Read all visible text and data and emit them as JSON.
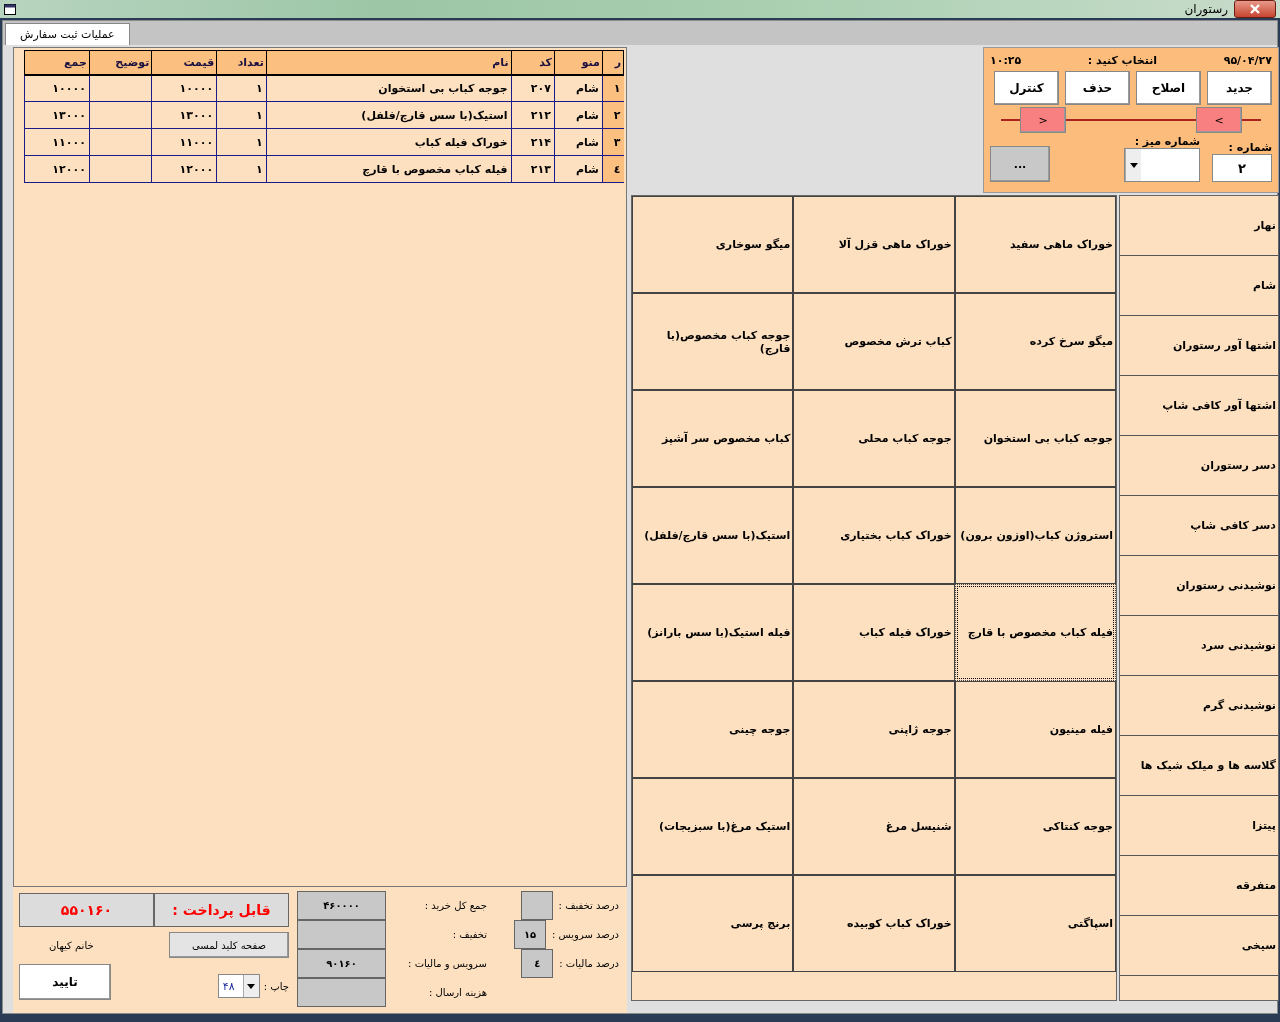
{
  "window": {
    "title": "رستوران"
  },
  "tabs": [
    {
      "label": "عملیات ثبت سفارش",
      "selected": true
    }
  ],
  "order_table": {
    "columns": [
      "ر",
      "منو",
      "کد",
      "نام",
      "تعداد",
      "قیمت",
      "توضیح",
      "جمع"
    ],
    "rows": [
      {
        "cells": [
          "۱",
          "شام",
          "۲۰۷",
          "جوجه کباب بی استخوان",
          "۱",
          "۱۰۰۰۰",
          "",
          "۱۰۰۰۰"
        ]
      },
      {
        "cells": [
          "۲",
          "شام",
          "۲۱۲",
          "استیک(با سس قارچ/فلفل)",
          "۱",
          "۱۳۰۰۰",
          "",
          "۱۳۰۰۰"
        ]
      },
      {
        "cells": [
          "۳",
          "شام",
          "۲۱۴",
          "خوراک فیله کباب",
          "۱",
          "۱۱۰۰۰",
          "",
          "۱۱۰۰۰"
        ]
      },
      {
        "cells": [
          "٤",
          "شام",
          "۲۱۳",
          "فیله کباب مخصوص با قارچ",
          "۱",
          "۱۲۰۰۰",
          "",
          "۱۲۰۰۰"
        ]
      }
    ]
  },
  "control_panel": {
    "date": "۹۵/۰۴/۲۷",
    "prompt": "انتخاب کنید :",
    "time": "۱۰:۲۵",
    "buttons": [
      "جدید",
      "اصلاح",
      "حذف",
      "کنترل"
    ],
    "next": ">",
    "prev": "<",
    "table_label": "شماره میز :",
    "number_label": "شماره :",
    "number_value": "۲",
    "more": "..."
  },
  "menu_items": [
    {
      "label": "خوراک ماهی سفید",
      "focused": false
    },
    {
      "label": "خوراک ماهی قزل آلا",
      "focused": false
    },
    {
      "label": "میگو سوخاری",
      "focused": false
    },
    {
      "label": "میگو سرخ کرده",
      "focused": false
    },
    {
      "label": "کباب ترش مخصوص",
      "focused": false
    },
    {
      "label": "جوجه کباب مخصوص(با قارچ)",
      "focused": false
    },
    {
      "label": "جوجه کباب بی استخوان",
      "focused": false
    },
    {
      "label": "جوجه کباب محلی",
      "focused": false
    },
    {
      "label": "کباب مخصوص سر آشپز",
      "focused": false
    },
    {
      "label": "استروژن کباب(اوزون برون)",
      "focused": false
    },
    {
      "label": "خوراک کباب بختیاری",
      "focused": false
    },
    {
      "label": "استیک(با سس قارچ/فلفل)",
      "focused": false
    },
    {
      "label": "فیله کباب مخصوص با قارچ",
      "focused": true
    },
    {
      "label": "خوراک فیله کباب",
      "focused": false
    },
    {
      "label": "فیله استیک(با سس بارانز)",
      "focused": false
    },
    {
      "label": "فیله مینیون",
      "focused": false
    },
    {
      "label": "جوجه ژاپنی",
      "focused": false
    },
    {
      "label": "جوجه چینی",
      "focused": false
    },
    {
      "label": "جوجه کنتاکی",
      "focused": false
    },
    {
      "label": "شنیسل مرغ",
      "focused": false
    },
    {
      "label": "استیک مرغ(با سبزیجات)",
      "focused": false
    },
    {
      "label": "اسپاگتی",
      "focused": false
    },
    {
      "label": "خوراک کباب کوبیده",
      "focused": false
    },
    {
      "label": "برنج پرسی",
      "focused": false
    }
  ],
  "categories": [
    "نهار",
    "شام",
    "اشتها آور رستوران",
    "اشتها آور کافی شاپ",
    "دسر رستوران",
    "دسر کافی شاپ",
    "نوشیدنی رستوران",
    "نوشیدنی سرد",
    "نوشیدنی گرم",
    "گلاسه ها و میلک شیک ها",
    "پیتزا",
    "متفرقه",
    "سیخی"
  ],
  "summary": {
    "payable_label": "قابل پرداخت :",
    "payable_value": "۵۵۰۱۶۰",
    "user": "خانم کیهان",
    "keyboard_button": "صفحه کلید لمسی",
    "confirm_button": "تایید",
    "print_label": "چاپ :",
    "print_value": "۴۸",
    "totals": [
      {
        "label": "جمع کل خرید :",
        "value": "۴۶۰۰۰۰"
      },
      {
        "label": "تخفیف :"
      },
      {
        "label": "سرویس و مالیات :",
        "value": "۹۰۱۶۰"
      },
      {
        "label": "هزینه ارسال :"
      }
    ],
    "percents": [
      {
        "label": "درصد تخفیف :"
      },
      {
        "label": "درصد سرویس :",
        "value": "۱۵"
      },
      {
        "label": "درصد مالیات :",
        "value": "٤"
      }
    ]
  }
}
